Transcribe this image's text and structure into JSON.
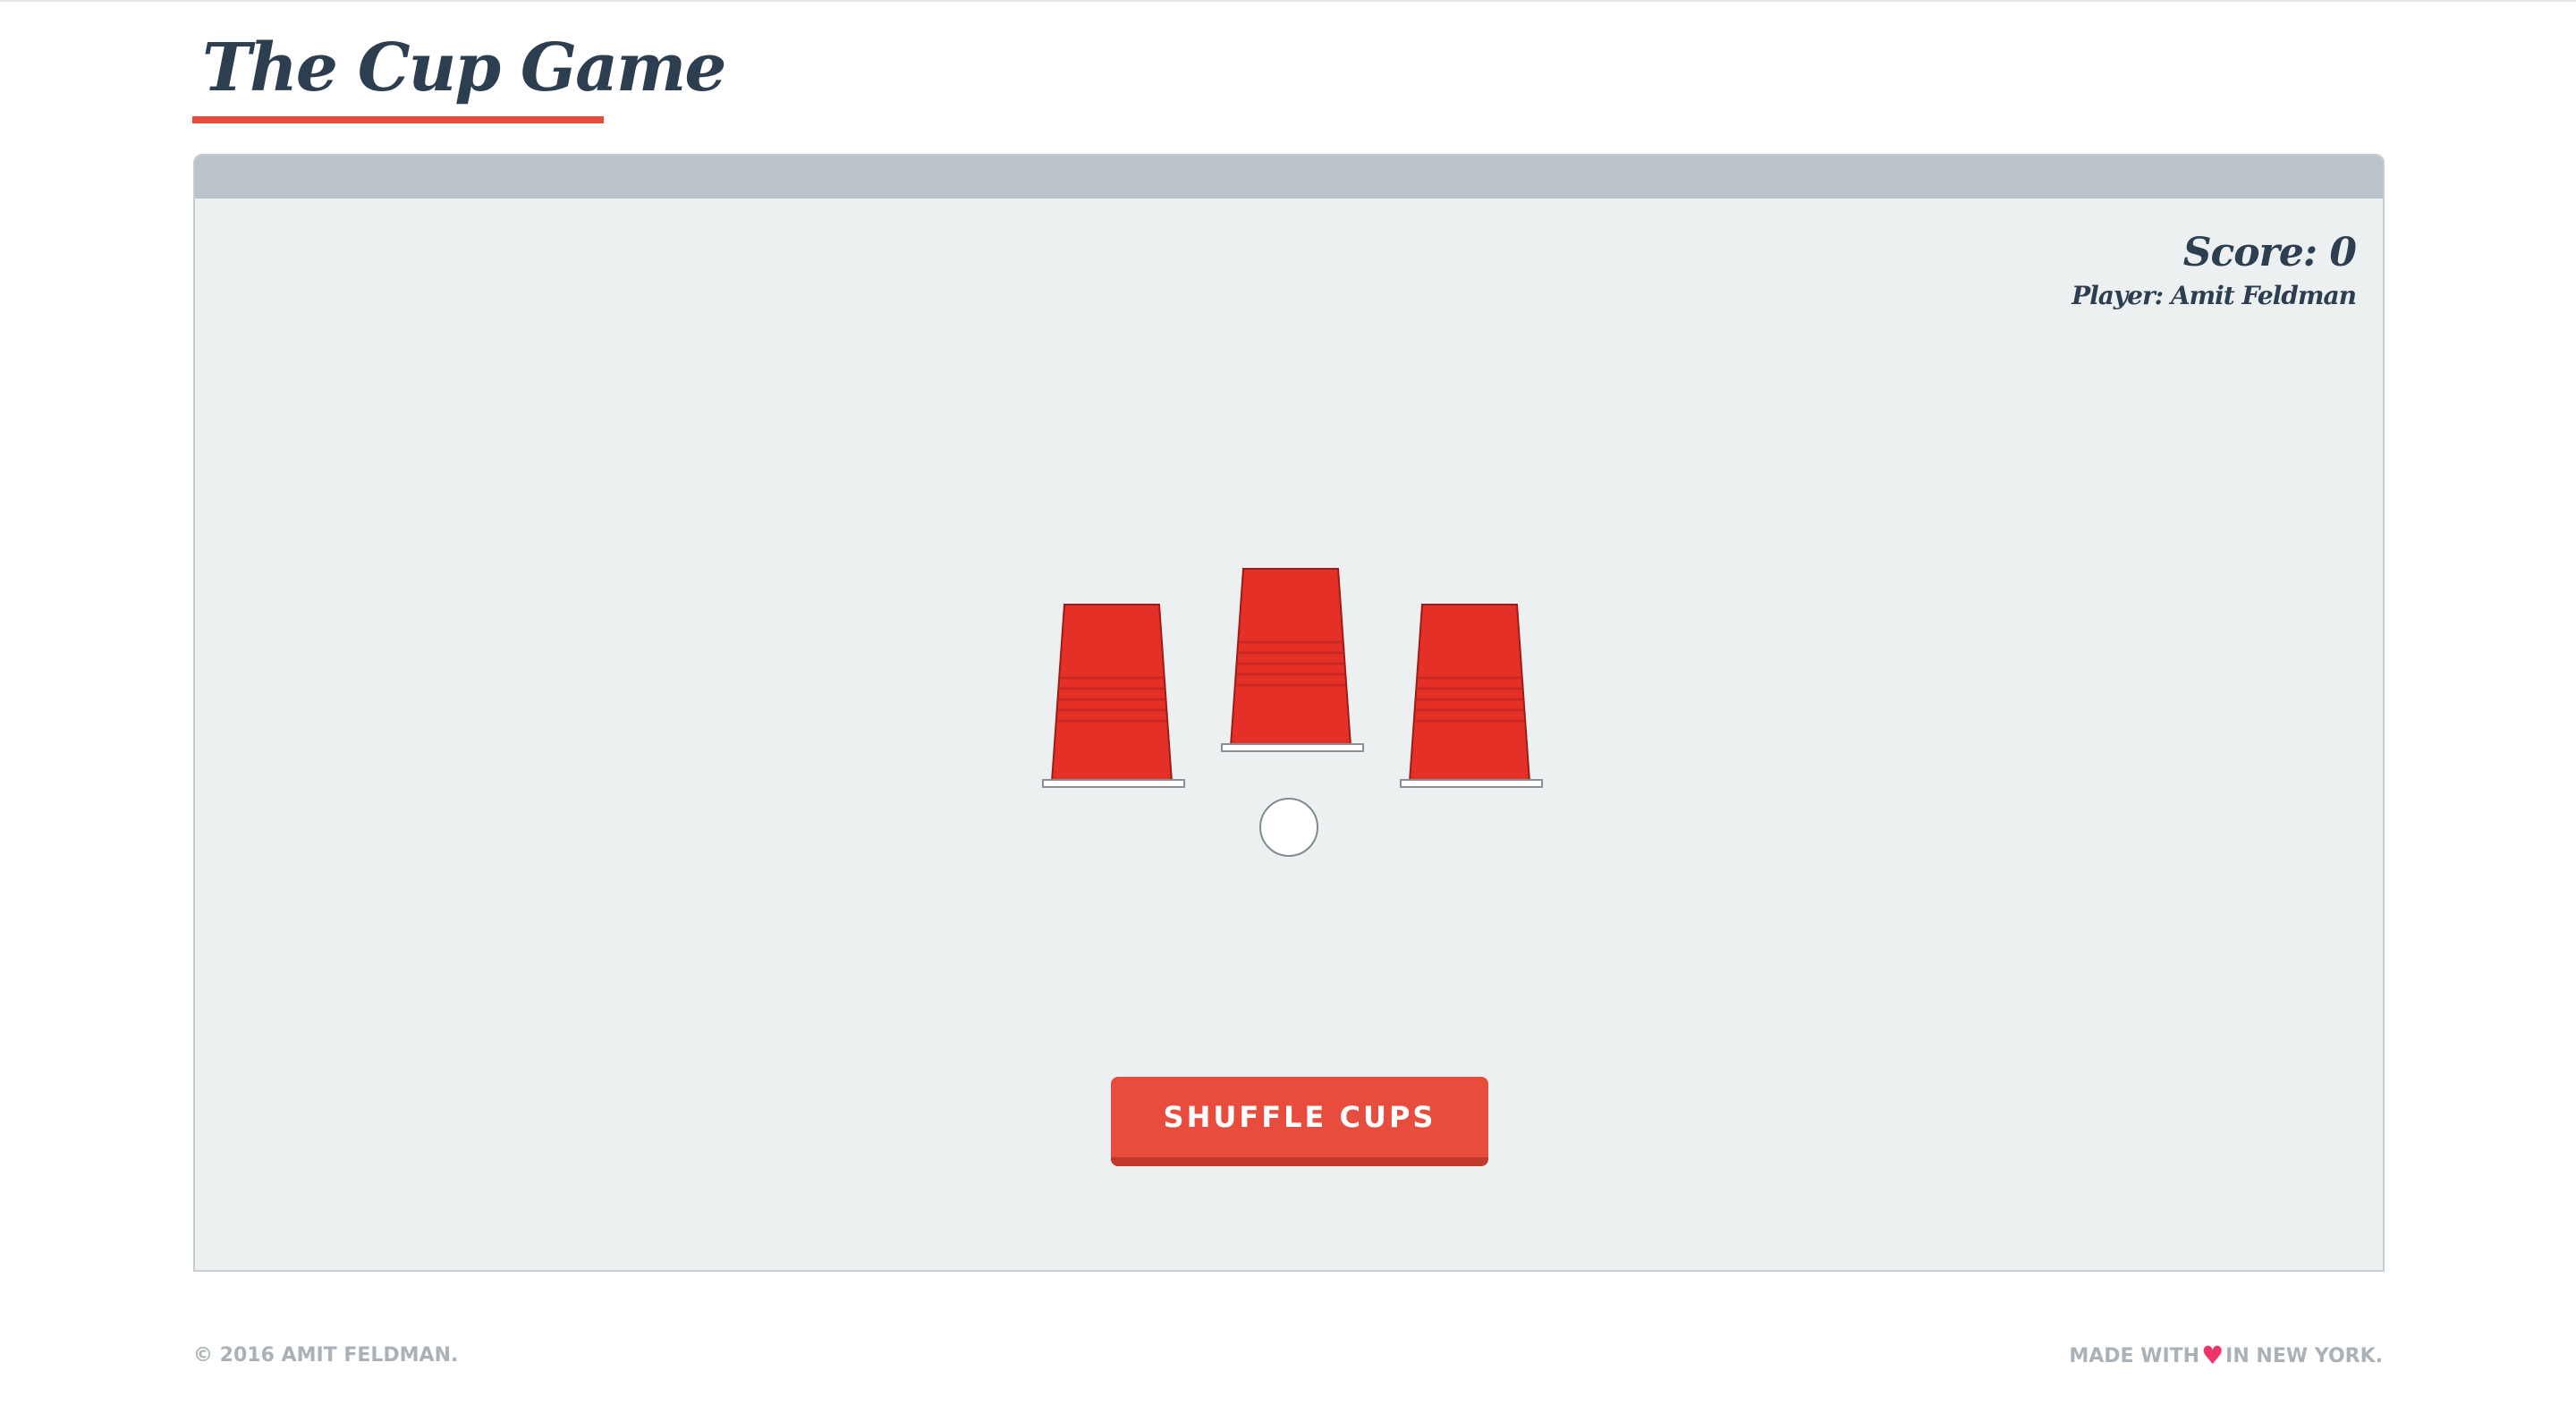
{
  "header": {
    "title": "The Cup Game"
  },
  "game": {
    "score_text": "Score: 0",
    "player_text": "Player: Amit Feldman",
    "cups_count": 3,
    "shuffle_label": "SHUFFLE CUPS"
  },
  "footer": {
    "copyright": "© 2016 AMIT FELDMAN.",
    "made_with_prefix": "MADE WITH",
    "heart_icon": "heart-icon",
    "made_with_suffix": "IN NEW YORK."
  },
  "colors": {
    "brand_red": "#e74c3c",
    "dark_text": "#2c3e50",
    "panel_bg": "#ecf0f1",
    "panel_header": "#bac3c9",
    "cup_red": "#e53027",
    "heart": "#f0346a",
    "footer_text": "#aab2b8"
  }
}
